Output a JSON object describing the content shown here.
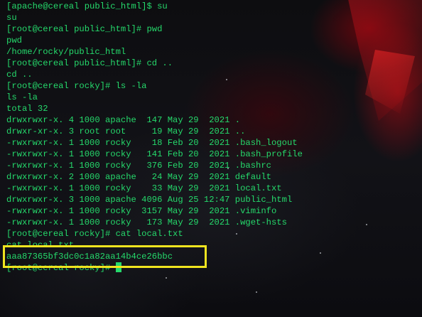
{
  "terminal": {
    "lines": [
      "[apache@cereal public_html]$ su",
      "su",
      "[root@cereal public_html]# pwd",
      "pwd",
      "/home/rocky/public_html",
      "[root@cereal public_html]# cd ..",
      "cd ..",
      "[root@cereal rocky]# ls -la",
      "ls -la",
      "total 32",
      "drwxrwxr-x. 4 1000 apache  147 May 29  2021 .",
      "drwxr-xr-x. 3 root root     19 May 29  2021 ..",
      "-rwxrwxr-x. 1 1000 rocky    18 Feb 20  2021 .bash_logout",
      "-rwxrwxr-x. 1 1000 rocky   141 Feb 20  2021 .bash_profile",
      "-rwxrwxr-x. 1 1000 rocky   376 Feb 20  2021 .bashrc",
      "drwxrwxr-x. 2 1000 apache   24 May 29  2021 default",
      "-rwxrwxr-x. 1 1000 rocky    33 May 29  2021 local.txt",
      "drwxrwxr-x. 3 1000 apache 4096 Aug 25 12:47 public_html",
      "-rwxrwxr-x. 1 1000 rocky  3157 May 29  2021 .viminfo",
      "-rwxrwxr-x. 1 1000 rocky   173 May 29  2021 .wget-hsts",
      "[root@cereal rocky]# cat local.txt",
      "cat local.txt",
      "aaa87365bf3dc0c1a82aa14b4ce26bbc"
    ],
    "prompt": "[root@cereal rocky]# "
  },
  "colors": {
    "terminal_text": "#25d96b",
    "highlight_box": "#f0e41f",
    "background": "#0a0a0c"
  }
}
